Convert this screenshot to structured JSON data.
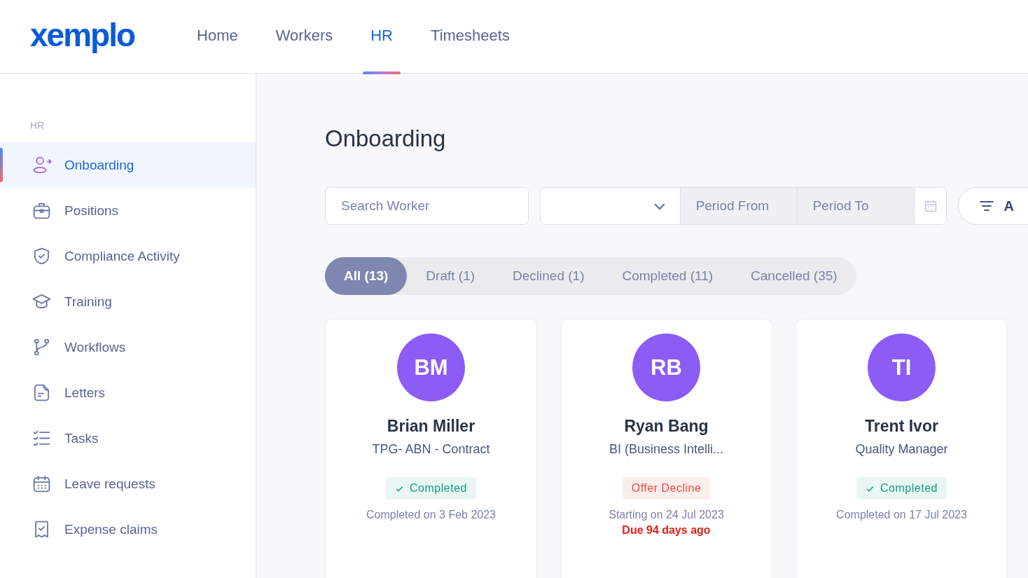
{
  "logo": "xemplo",
  "nav": [
    {
      "label": "Home",
      "selected": false
    },
    {
      "label": "Workers",
      "selected": false
    },
    {
      "label": "HR",
      "selected": true
    },
    {
      "label": "Timesheets",
      "selected": false
    }
  ],
  "sidebar": {
    "section": "HR",
    "items": [
      {
        "label": "Onboarding",
        "selected": true
      },
      {
        "label": "Positions",
        "selected": false
      },
      {
        "label": "Compliance Activity",
        "selected": false
      },
      {
        "label": "Training",
        "selected": false
      },
      {
        "label": "Workflows",
        "selected": false
      },
      {
        "label": "Letters",
        "selected": false
      },
      {
        "label": "Tasks",
        "selected": false
      },
      {
        "label": "Leave requests",
        "selected": false
      },
      {
        "label": "Expense claims",
        "selected": false
      }
    ]
  },
  "page_title": "Onboarding",
  "filters": {
    "search": {
      "placeholder": "Search Worker"
    },
    "period_from": {
      "placeholder": "Period From"
    },
    "period_to": {
      "placeholder": "Period To"
    },
    "filter_button": "A"
  },
  "status_tabs": [
    {
      "label": "All (13)",
      "selected": true
    },
    {
      "label": "Draft (1)",
      "selected": false
    },
    {
      "label": "Declined (1)",
      "selected": false
    },
    {
      "label": "Completed (11)",
      "selected": false
    },
    {
      "label": "Cancelled (35)",
      "selected": false
    }
  ],
  "cards": [
    {
      "initials": "BM",
      "name": "Brian Miller",
      "position": "TPG- ABN - Contract",
      "status": {
        "kind": "completed",
        "label": "Completed"
      },
      "date": "Completed on 3 Feb 2023"
    },
    {
      "initials": "RB",
      "name": "Ryan Bang",
      "position": "BI (Business Intelli...",
      "status": {
        "kind": "declined",
        "label": "Offer Decline"
      },
      "date": "Starting on 24 Jul 2023",
      "due": "Due 94 days ago"
    },
    {
      "initials": "TI",
      "name": "Trent Ivor",
      "position": "Quality Manager",
      "status": {
        "kind": "completed",
        "label": "Completed"
      },
      "date": "Completed on 17 Jul 2023"
    }
  ]
}
